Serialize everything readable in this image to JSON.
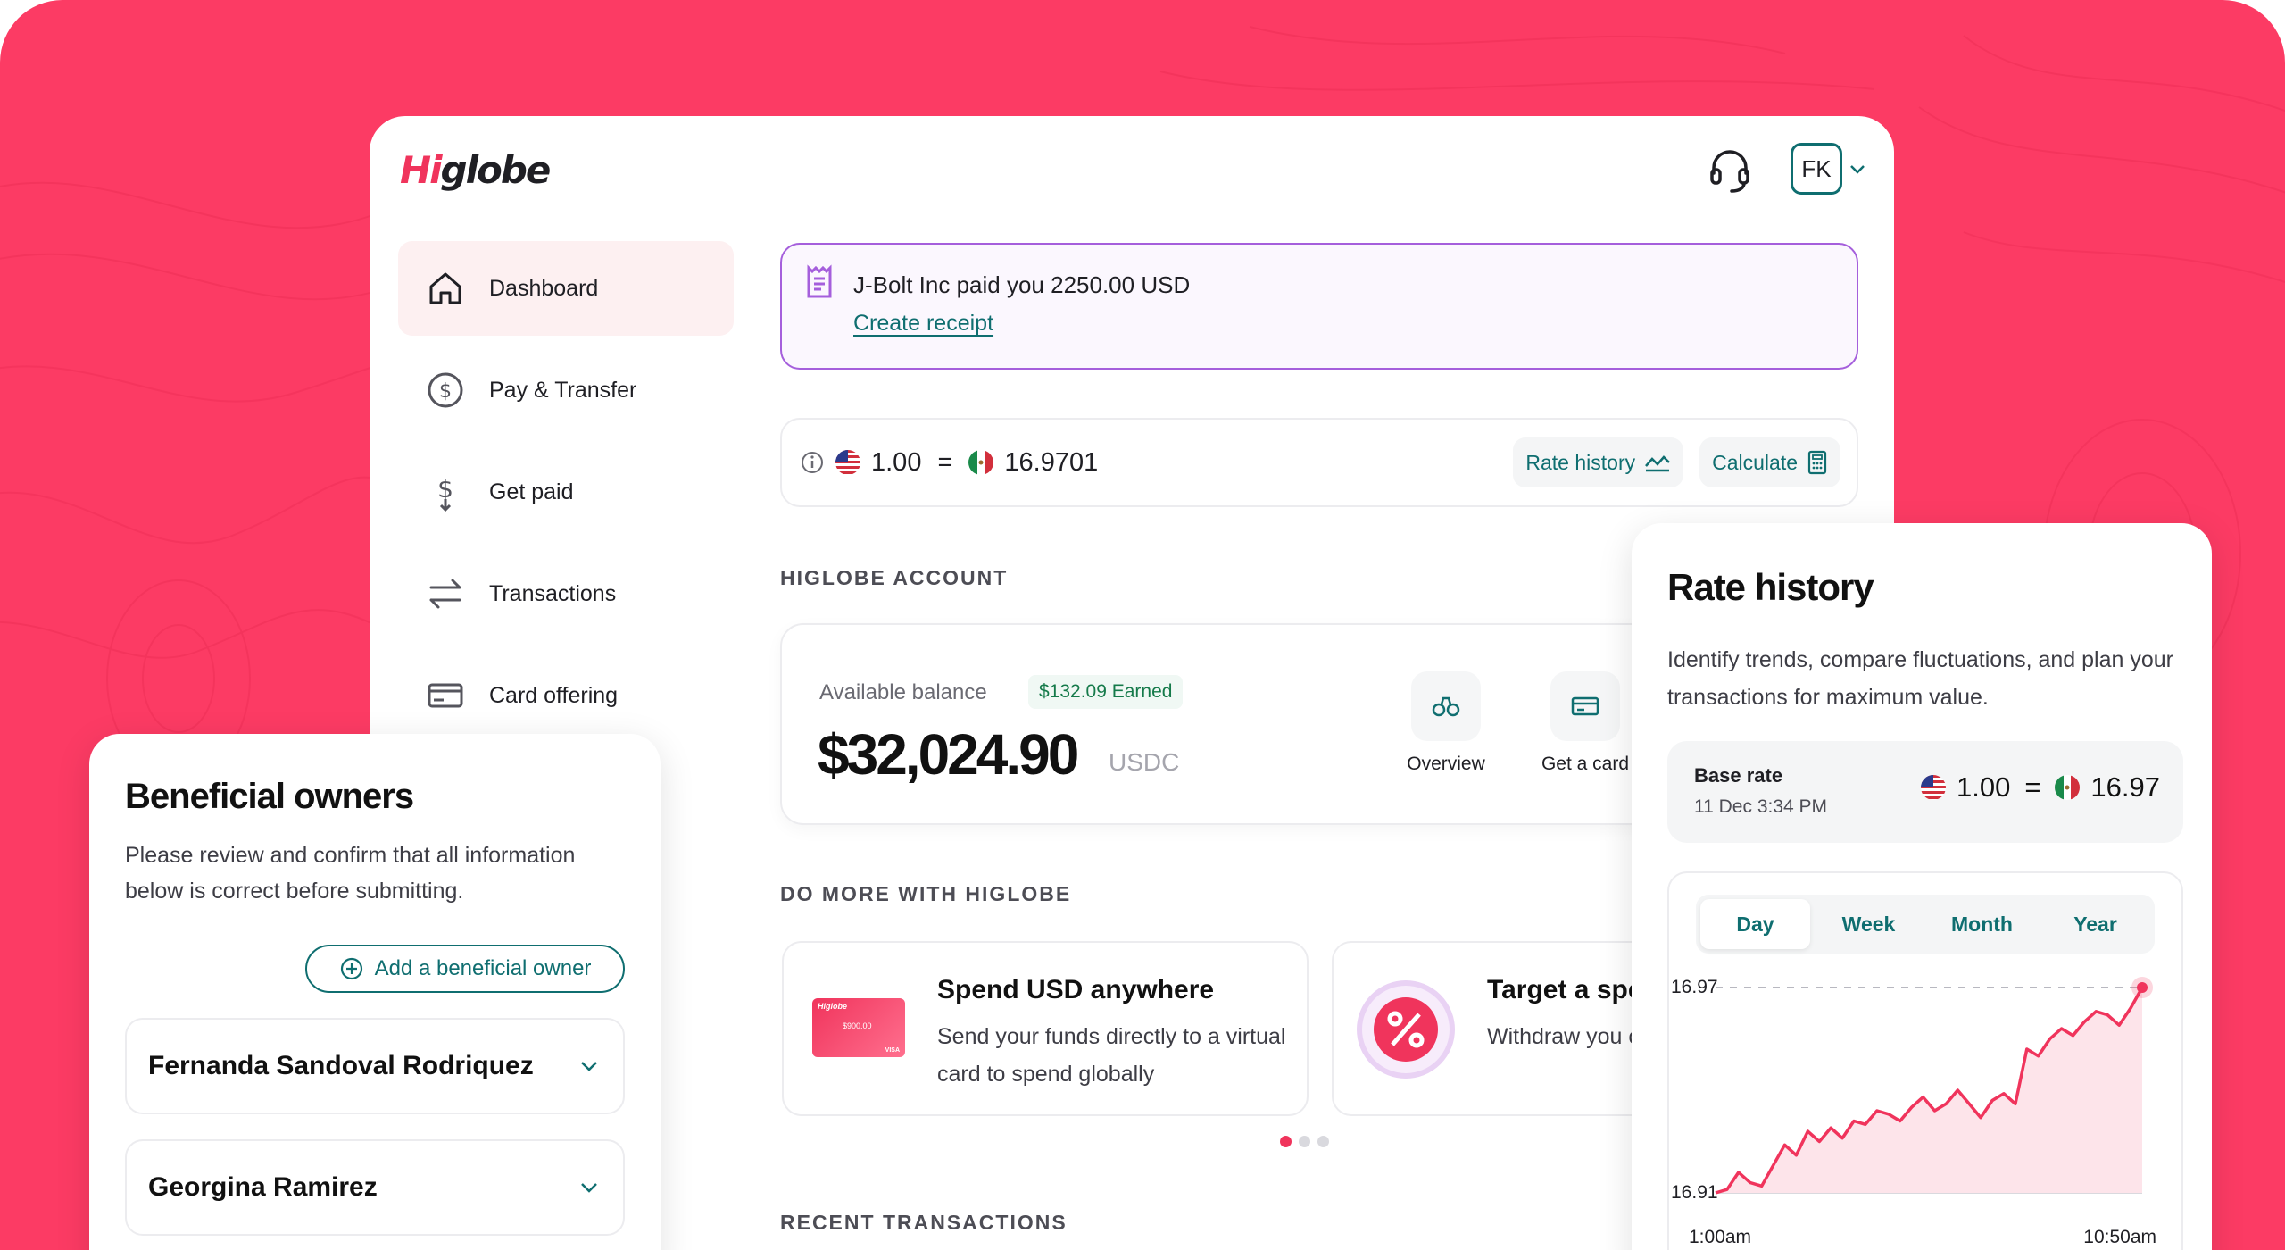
{
  "brand": {
    "logo_prefix": "Hi",
    "logo_rest": "globe"
  },
  "header": {
    "avatar_initials": "FK"
  },
  "sidebar": {
    "items": [
      {
        "label": "Dashboard",
        "icon": "home-icon",
        "active": true
      },
      {
        "label": "Pay & Transfer",
        "icon": "dollar-circle-icon"
      },
      {
        "label": "Get paid",
        "icon": "dollar-arrow-icon"
      },
      {
        "label": "Transactions",
        "icon": "swap-arrows-icon"
      },
      {
        "label": "Card offering",
        "icon": "card-icon"
      }
    ]
  },
  "notice": {
    "message": "J-Bolt Inc paid you 2250.00 USD",
    "link": "Create receipt"
  },
  "rate_bar": {
    "from_amount": "1.00",
    "equals": "=",
    "to_amount": "16.9701",
    "rate_history_label": "Rate history",
    "calculate_label": "Calculate"
  },
  "account": {
    "section_label": "HIGLOBE ACCOUNT",
    "balance_label": "Available balance",
    "earned": "$132.09 Earned",
    "balance": "$32,024.90",
    "currency": "USDC",
    "actions": [
      {
        "label": "Overview"
      },
      {
        "label": "Get a card"
      }
    ]
  },
  "do_more": {
    "section_label": "DO MORE WITH HIGLOBE",
    "cards": [
      {
        "title": "Spend USD anywhere",
        "desc": "Send your funds directly to a virtual card to spend globally",
        "card_brand": "Higlobe",
        "card_amount": "$900.00",
        "card_network": "VISA"
      },
      {
        "title": "Target a spe",
        "desc": "Withdraw you chosen by you"
      }
    ]
  },
  "recent": {
    "section_label": "RECENT TRANSACTIONS"
  },
  "beneficial_owners": {
    "title": "Beneficial owners",
    "desc": "Please review and confirm that all information below is correct before submitting.",
    "add_label": "Add a beneficial owner",
    "owners": [
      {
        "name": "Fernanda Sandoval Rodriquez"
      },
      {
        "name": "Georgina Ramirez"
      }
    ]
  },
  "rate_history": {
    "title": "Rate history",
    "desc": "Identify trends, compare fluctuations, and plan your transactions for maximum value.",
    "base_title": "Base rate",
    "base_date": "11 Dec 3:34 PM",
    "base_from": "1.00",
    "base_equals": "=",
    "base_to": "16.97",
    "tabs": [
      {
        "label": "Day",
        "active": true
      },
      {
        "label": "Week"
      },
      {
        "label": "Month"
      },
      {
        "label": "Year"
      }
    ]
  },
  "chart_data": {
    "type": "area",
    "ylim": [
      16.91,
      16.97
    ],
    "yticks": [
      "16.97",
      "16.91"
    ],
    "xticks": [
      "1:00am",
      "10:50am"
    ],
    "values": [
      16.91,
      16.911,
      16.916,
      16.913,
      16.912,
      16.918,
      16.924,
      16.921,
      16.928,
      16.925,
      16.929,
      16.926,
      16.931,
      16.93,
      16.934,
      16.933,
      16.931,
      16.935,
      16.938,
      16.934,
      16.936,
      16.94,
      16.936,
      16.932,
      16.937,
      16.939,
      16.936,
      16.952,
      16.95,
      16.955,
      16.958,
      16.956,
      16.96,
      16.963,
      16.962,
      16.959,
      16.964,
      16.97
    ],
    "colors": {
      "line": "#f0345c",
      "fill": "#fde4ea"
    }
  },
  "colors": {
    "accent": "#f0345c",
    "teal": "#0f6e70",
    "background": "#fc3b64"
  }
}
